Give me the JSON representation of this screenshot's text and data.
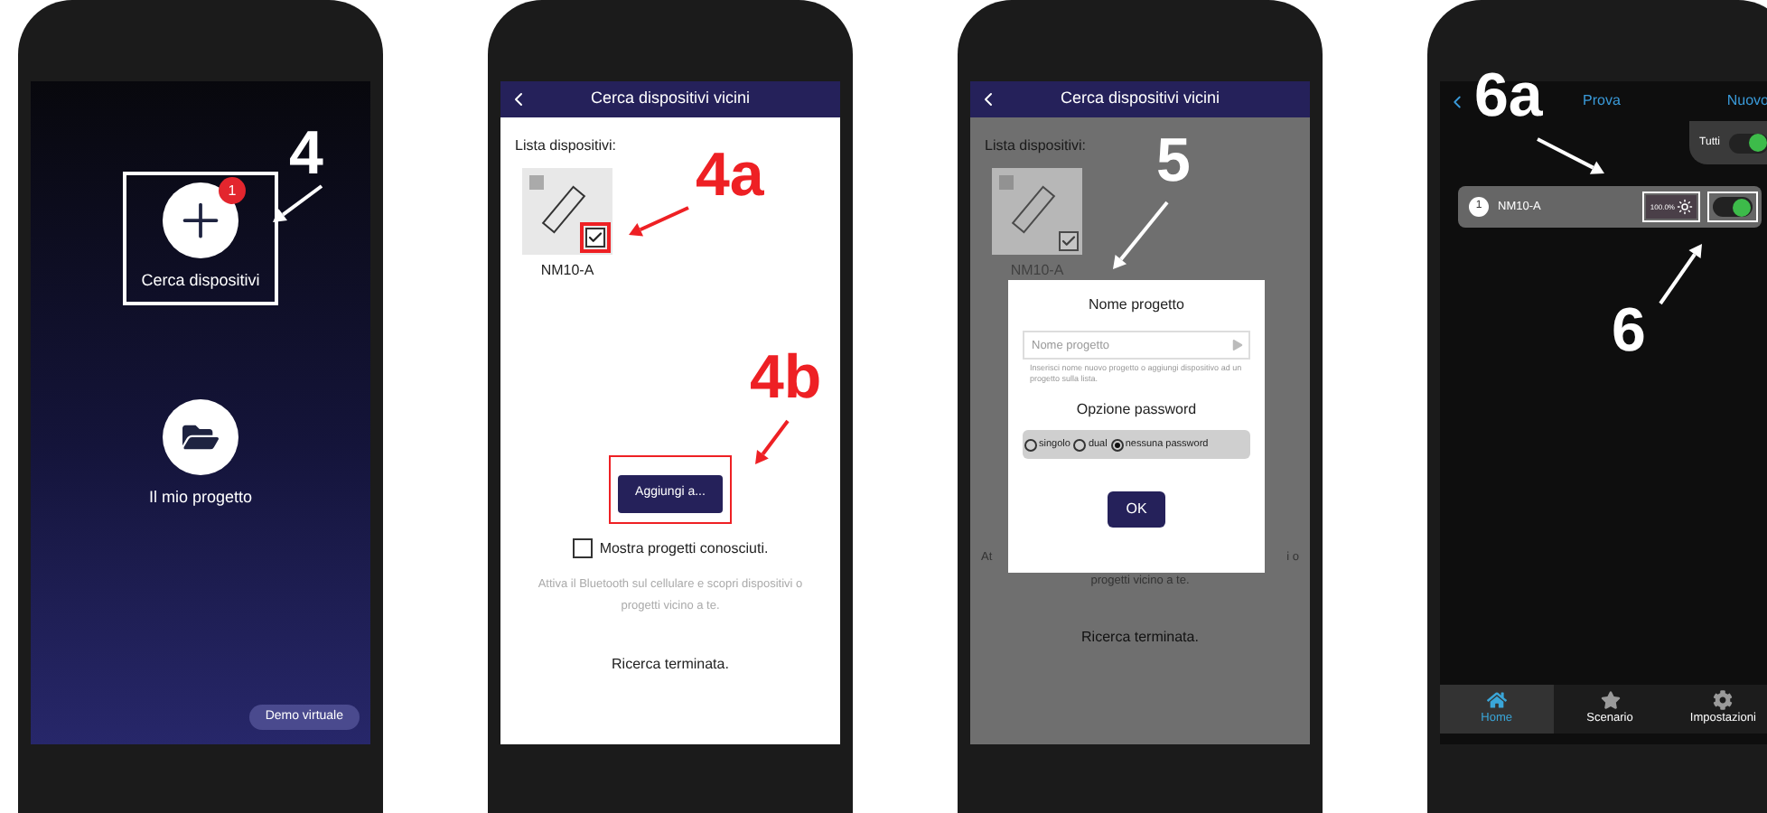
{
  "phones": [
    {
      "kind": "home",
      "items": [
        {
          "label": "Cerca dispositivi",
          "badge": "1",
          "highlighted": true
        },
        {
          "label": "Il mio progetto",
          "highlighted": false
        }
      ],
      "demo_button": "Demo virtuale",
      "annotations": [
        {
          "label": "4",
          "color": "#ffffff"
        }
      ]
    },
    {
      "kind": "search",
      "title": "Cerca dispositivi vicini",
      "list_label": "Lista dispositivi:",
      "devices": [
        {
          "name": "NM10-A",
          "checked": true
        }
      ],
      "add_button": "Aggiungi a...",
      "show_known": {
        "label": "Mostra progetti conosciuti.",
        "checked": false
      },
      "hint": "Attiva il Bluetooth sul cellulare e scopri dispositivi o progetti vicino a te.",
      "status": "Ricerca terminata.",
      "annotations": [
        {
          "label": "4a",
          "color": "#ee2024"
        },
        {
          "label": "4b",
          "color": "#ee2024"
        }
      ]
    },
    {
      "kind": "dialog",
      "title": "Cerca dispositivi vicini",
      "list_label": "Lista dispositivi:",
      "devices": [
        {
          "name": "NM10-A",
          "checked": true
        }
      ],
      "hint_fragments": [
        "At",
        "i o"
      ],
      "hint_tail": "progetti vicino a te.",
      "status": "Ricerca terminata.",
      "dialog": {
        "title": "Nome progetto",
        "placeholder": "Nome progetto",
        "help": "Inserisci nome nuovo progetto o aggiungi dispositivo ad un progetto sulla lista.",
        "password_title": "Opzione password",
        "options": [
          {
            "label": "singolo",
            "selected": false
          },
          {
            "label": "dual",
            "selected": false
          },
          {
            "label": "nessuna password",
            "selected": true
          }
        ],
        "ok": "OK"
      },
      "annotations": [
        {
          "label": "5",
          "color": "#ffffff"
        }
      ]
    },
    {
      "kind": "control",
      "tabs": [
        "Prova",
        "Nuovo"
      ],
      "all_toggle": {
        "label": "Tutti",
        "on": true
      },
      "devices": [
        {
          "index": "1",
          "name": "NM10-A",
          "brightness": "100.0%",
          "on": true
        }
      ],
      "nav": [
        {
          "label": "Home",
          "selected": true
        },
        {
          "label": "Scenario",
          "selected": false
        },
        {
          "label": "Impostazioni",
          "selected": false
        }
      ],
      "annotations": [
        {
          "label": "6a",
          "color": "#ffffff"
        },
        {
          "label": "6",
          "color": "#ffffff"
        }
      ]
    }
  ]
}
